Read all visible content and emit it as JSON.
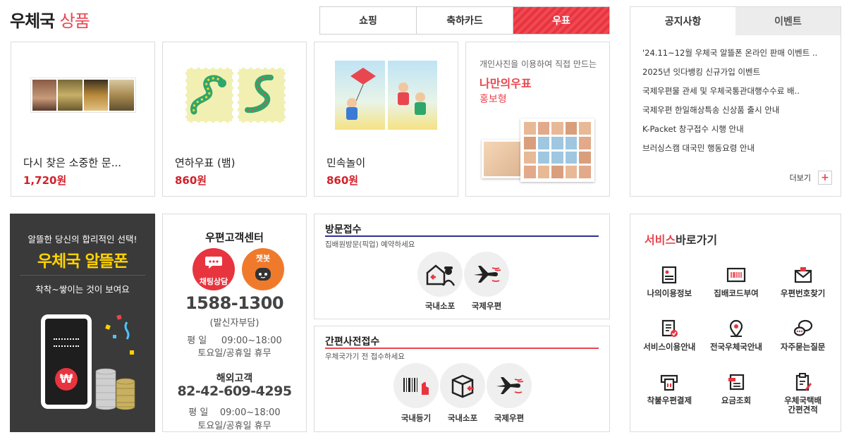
{
  "title": {
    "main": "우체국",
    "highlight": "상품"
  },
  "tabs": [
    {
      "label": "쇼핑",
      "active": false
    },
    {
      "label": "축하카드",
      "active": false
    },
    {
      "label": "우표",
      "active": true
    }
  ],
  "products": [
    {
      "name": "다시 찾은 소중한 문...",
      "price": "1,720원"
    },
    {
      "name": "연하우표 (뱀)",
      "price": "860원"
    },
    {
      "name": "민속놀이",
      "price": "860원"
    }
  ],
  "promo": {
    "line1": "개인사진을 이용하여 직접 만드는",
    "line2": "나만의우표",
    "line3": "홍보형"
  },
  "notice": {
    "tabs": [
      "공지사항",
      "이벤트"
    ],
    "items": [
      "'24.11~12월 우체국 알뜰폰 온라인 판매 이벤트 ..",
      "2025년 잇다뱅킹 신규가입 이벤트",
      "국제우편물 관세 및 우체국통관대행수수료 배..",
      "국제우편 한일해상특송 신상품 출시 안내",
      "K-Packet 창구접수 시행 안내",
      "브러싱스캠 대국민 행동요령 안내"
    ],
    "more_label": "더보기",
    "more_icon": "+"
  },
  "ad": {
    "line1": "알뜰한 당신의 합리적인 선택!",
    "line2": "우체국 알뜰폰",
    "line3": "착착~쌓이는 것이 보여요",
    "phone_symbol": "₩"
  },
  "customer_center": {
    "title": "우편고객센터",
    "chat_label": "채팅상담",
    "chatbot_label": "챗봇",
    "phone": "1588-1300",
    "phone_note": "(발신자부담)",
    "weekday": "평 일     09:00~18:00",
    "weekend": "토요일/공휴일 휴무",
    "overseas_title": "해외고객",
    "overseas_phone": "82-42-609-4295",
    "overseas_weekday": "평 일    09:00~18:00",
    "overseas_weekend": "토요일/공휴일 휴무"
  },
  "visit": {
    "title": "방문접수",
    "subtitle": "집배원방문(픽업) 예약하세요",
    "items": [
      "국내소포",
      "국제우편"
    ],
    "accent": "#2e3192"
  },
  "simple": {
    "title": "간편사전접수",
    "subtitle": "우체국가기 전 접수하세요",
    "items": [
      "국내등기",
      "국내소포",
      "국제우편"
    ],
    "accent": "#e8474f"
  },
  "services": {
    "title_highlight": "서비스",
    "title_rest": "바로가기",
    "items": [
      {
        "label": "나의이용정보",
        "icon": "user-info-icon"
      },
      {
        "label": "집배코드부여",
        "icon": "barcode-icon"
      },
      {
        "label": "우편번호찾기",
        "icon": "envelope-icon"
      },
      {
        "label": "서비스이용안내",
        "icon": "guide-icon"
      },
      {
        "label": "전국우체국안내",
        "icon": "location-pin-icon"
      },
      {
        "label": "자주묻는질문",
        "icon": "chat-bubbles-icon"
      },
      {
        "label": "착불우편결제",
        "icon": "payment-terminal-icon"
      },
      {
        "label": "요금조회",
        "icon": "receipt-icon"
      },
      {
        "label": "우체국택배\n간편견적",
        "icon": "clipboard-edit-icon"
      }
    ]
  },
  "colors": {
    "brand_red": "#e8474f",
    "price_red": "#d3202a",
    "ad_yellow": "#ffd200",
    "visit_navy": "#2e3192"
  }
}
